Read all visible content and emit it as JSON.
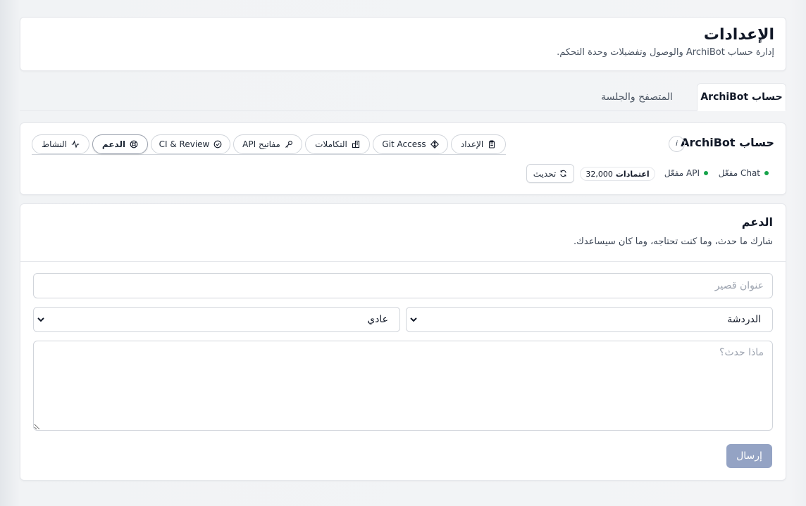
{
  "header": {
    "title": "الإعدادات",
    "subtitle": "إدارة حساب ArchiBot والوصول وتفضيلات وحدة التحكم."
  },
  "main_tabs": [
    {
      "label": "حساب ArchiBot",
      "active": true
    },
    {
      "label": "المتصفح والجلسة",
      "active": false
    }
  ],
  "account": {
    "title": "حساب ArchiBot",
    "info_label": "i",
    "subtabs": [
      {
        "label": "الإعداد",
        "icon": "clipboard-icon",
        "active": false
      },
      {
        "label": "Git Access",
        "icon": "git-icon",
        "active": false
      },
      {
        "label": "التكاملات",
        "icon": "integrations-icon",
        "active": false
      },
      {
        "label": "مفاتيح API",
        "icon": "key-icon",
        "active": false
      },
      {
        "label": "CI & Review",
        "icon": "check-circle-icon",
        "active": false
      },
      {
        "label": "الدعم",
        "icon": "lifebuoy-icon",
        "active": true
      },
      {
        "label": "النشاط",
        "icon": "activity-icon",
        "active": false
      }
    ],
    "status": {
      "chat": "Chat مفعّل",
      "api": "API مفعّل",
      "credits_value": "32,000",
      "credits_label": "اعتمادات",
      "refresh_label": "تحديث",
      "status_color": "#16a34a"
    }
  },
  "support": {
    "title": "الدعم",
    "description": "شارك ما حدث، وما كنت تحتاجه، وما كان سيساعدك.",
    "title_placeholder": "عنوان قصير",
    "category_value": "الدردشة",
    "priority_value": "عادي",
    "message_placeholder": "ماذا حدث؟",
    "send_label": "إرسال",
    "send_color": "#94a3c4"
  }
}
